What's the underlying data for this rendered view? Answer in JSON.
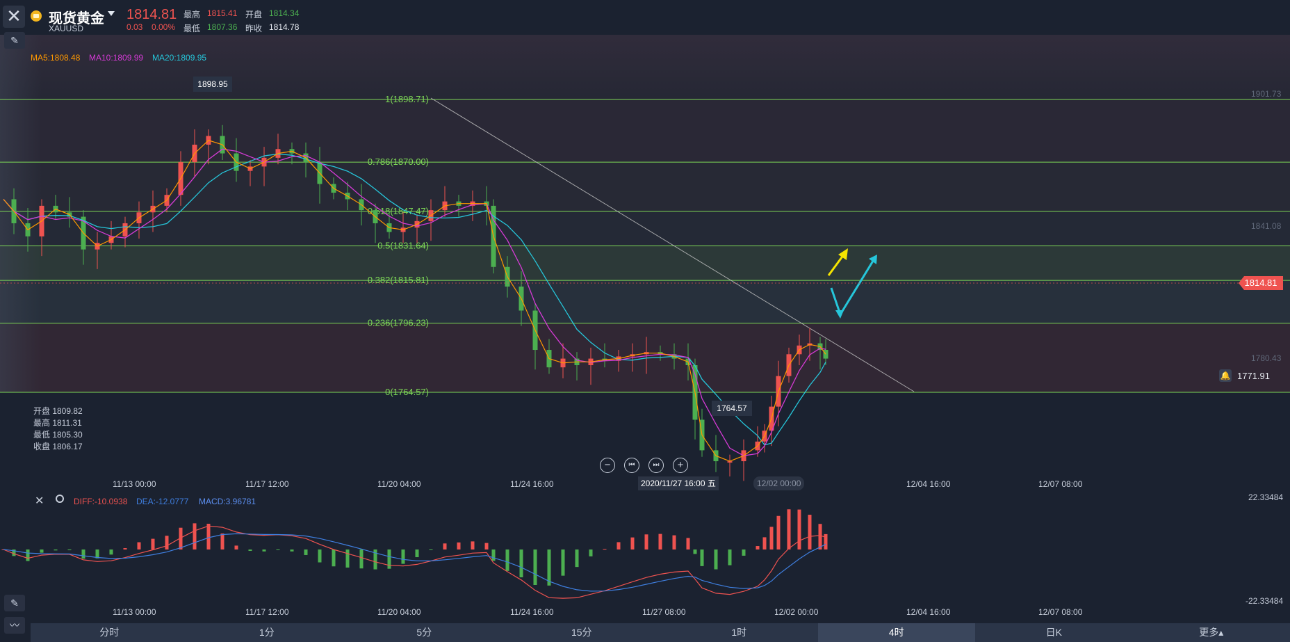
{
  "header": {
    "title": "现货黄金",
    "symbol": "XAUUSD",
    "price": "1814.81",
    "change": "0.03",
    "change_pct": "0.00%",
    "high_label": "最高",
    "high_value": "1815.41",
    "open_label": "开盘",
    "open_value": "1814.34",
    "low_label": "最低",
    "low_value": "1807.36",
    "prev_close_label": "昨收",
    "prev_close_value": "1814.78"
  },
  "ma": {
    "ma5": "MA5:1808.48",
    "ma10": "MA10:1809.99",
    "ma20": "MA20:1809.95"
  },
  "price_axis": [
    "1901.73",
    "1841.08",
    "1780.43"
  ],
  "current_price_tag": "1814.81",
  "alert_price": "1771.91",
  "high_marker": "1898.95",
  "low_marker": "1764.57",
  "fib_levels": [
    {
      "label": "1(1898.71)",
      "value": 1898.71
    },
    {
      "label": "0.786(1870.00)",
      "value": 1870.0
    },
    {
      "label": "0.618(1847.47)",
      "value": 1847.47
    },
    {
      "label": "0.5(1831.64)",
      "value": 1831.64
    },
    {
      "label": "0.382(1815.81)",
      "value": 1815.81
    },
    {
      "label": "0.236(1796.23)",
      "value": 1796.23
    },
    {
      "label": "0(1764.57)",
      "value": 1764.57
    }
  ],
  "ohlc_panel": {
    "open": "开盘 1809.82",
    "high": "最高 1811.31",
    "low": "最低 1805.30",
    "close": "收盘 1806.17"
  },
  "x_axis_top": [
    "11/13 00:00",
    "11/17 12:00",
    "11/20 04:00",
    "11/24 16:00",
    "12/04 16:00",
    "12/07 08:00"
  ],
  "crosshair_label": "2020/11/27 16:00 五",
  "crosshair_label_extra": "12/02 00:00",
  "macd": {
    "diff": "DIFF:-10.0938",
    "dea": "DEA:-12.0777",
    "macd": "MACD:3.96781",
    "top_value": "22.33484",
    "bottom_value": "-22.33484"
  },
  "x_axis_bottom": [
    "11/13 00:00",
    "11/17 12:00",
    "11/20 04:00",
    "11/24 16:00",
    "11/27 08:00",
    "12/02 00:00",
    "12/04 16:00",
    "12/07 08:00"
  ],
  "tabs": [
    {
      "label": "分时"
    },
    {
      "label": "1分"
    },
    {
      "label": "5分"
    },
    {
      "label": "15分"
    },
    {
      "label": "1时"
    },
    {
      "label": "4时"
    },
    {
      "label": "日K"
    },
    {
      "label": "更多▴"
    }
  ],
  "colors": {
    "up": "#ef5350",
    "down": "#4caf50",
    "ma5": "#ff9800",
    "ma10": "#d63bd6",
    "ma20": "#26c6da",
    "fib": "#7ed957",
    "background": "#1b2230"
  }
}
